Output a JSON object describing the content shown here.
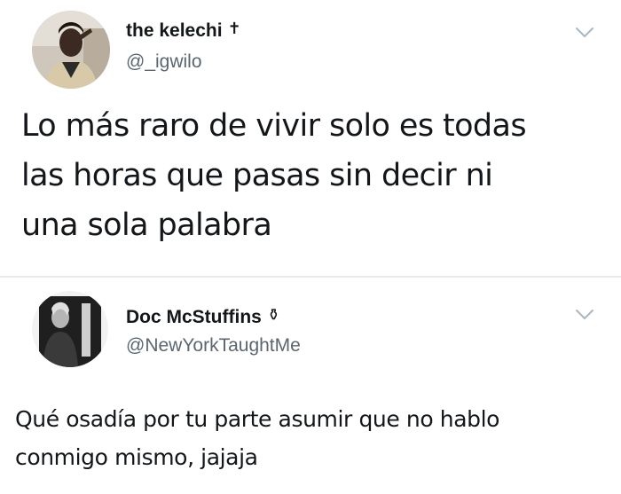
{
  "tweets": [
    {
      "display_name": "the kelechi",
      "badge": "✝",
      "handle": "@_igwilo",
      "text": "Lo más raro de vivir solo es todas\nlas horas que pasas sin decir ni\nuna sola palabra",
      "menu_icon": "chevron-down-icon"
    },
    {
      "display_name": "Doc McStuffins",
      "badge": "⚱",
      "handle": "@NewYorkTaughtMe",
      "text": "Qué osadía por tu parte asumir que no hablo\nconmigo mismo, jajaja",
      "menu_icon": "chevron-down-icon"
    }
  ],
  "colors": {
    "text": "#14171a",
    "secondary_text": "#5b6670",
    "chevron": "#aab8c2",
    "divider": "#e6ecf0"
  }
}
